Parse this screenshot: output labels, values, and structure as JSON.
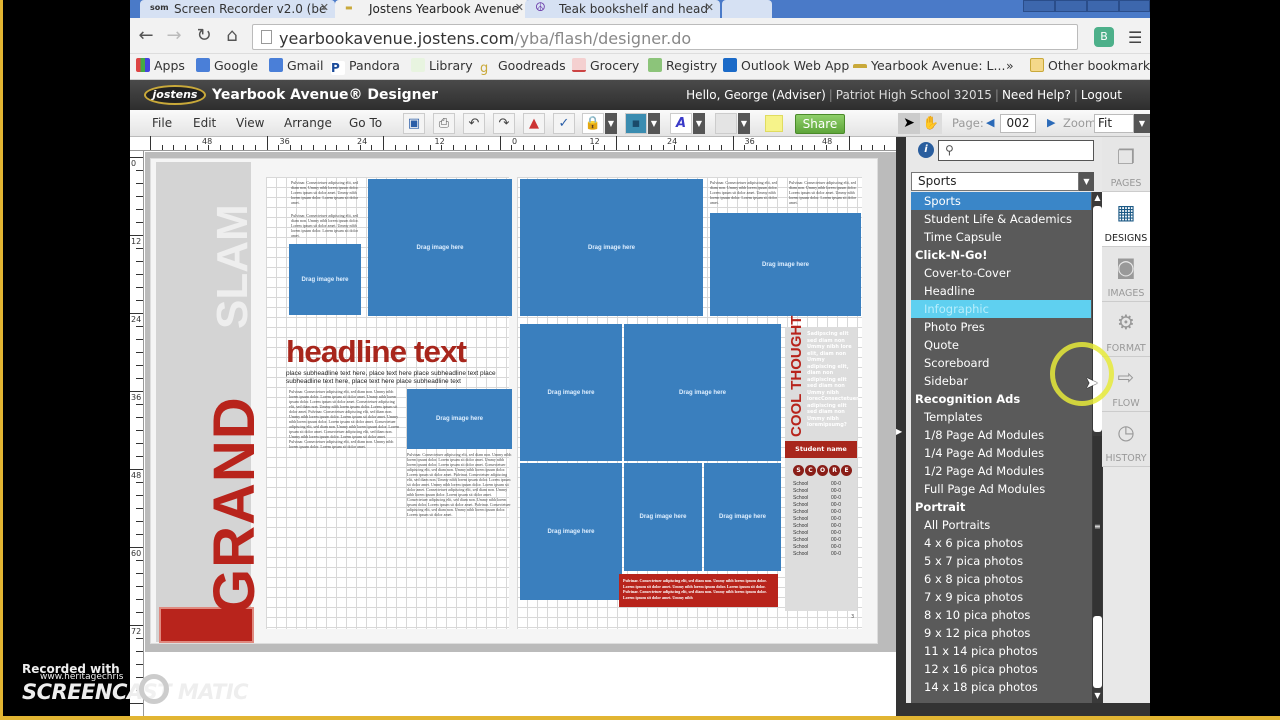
{
  "browser": {
    "tabs": [
      {
        "label": "Screen Recorder v2.0 (be",
        "icon": "som-icon",
        "active": false
      },
      {
        "label": "Jostens Yearbook Avenue",
        "icon": "yearbook-icon",
        "active": true
      },
      {
        "label": "Teak bookshelf and head",
        "icon": "peace-icon",
        "active": false
      }
    ],
    "url_domain": "yearbookavenue.jostens.com",
    "url_path": "/yba/flash/designer.do",
    "bookmarks": [
      {
        "label": "Apps",
        "icon": "apps-grid-icon",
        "color": "#d44"
      },
      {
        "label": "Google",
        "icon": "google-icon",
        "color": "#4a7fd8"
      },
      {
        "label": "Gmail",
        "icon": "gmail-icon",
        "color": "#4a7fd8"
      },
      {
        "label": "Pandora",
        "icon": "pandora-icon",
        "color": "#1a4a9a"
      },
      {
        "label": "Library",
        "icon": "library-icon",
        "color": "#7ab85a"
      },
      {
        "label": "Goodreads",
        "icon": "goodreads-icon",
        "color": "#c9a93a"
      },
      {
        "label": "Grocery",
        "icon": "grocery-icon",
        "color": "#c44"
      },
      {
        "label": "Registry",
        "icon": "registry-icon",
        "color": "#8cc47a"
      },
      {
        "label": "Outlook Web App",
        "icon": "outlook-icon",
        "color": "#1a6ac8"
      },
      {
        "label": "Yearbook Avenue: L...",
        "icon": "yearbook-icon",
        "color": "#c9a93a"
      }
    ],
    "more_bookmarks": "»",
    "other_bookmarks": "Other bookmarks"
  },
  "app": {
    "logo": "jostens",
    "title": "Yearbook Avenue® Designer",
    "greeting": "Hello, George (Adviser)",
    "school": "Patriot High School 32015",
    "help": "Need Help?",
    "logout": "Logout"
  },
  "toolbar": {
    "menus": [
      "File",
      "Edit",
      "View",
      "Arrange",
      "Go To"
    ],
    "share_label": "Share",
    "page_label": "Page:",
    "page_value": "002",
    "zoom_label": "Zoom",
    "zoom_value": "Fit"
  },
  "rulers": {
    "horizontal": [
      "48",
      "36",
      "24",
      "12",
      "0",
      "12",
      "24",
      "36",
      "48"
    ],
    "vertical": [
      "0",
      "12",
      "24",
      "36",
      "48",
      "60",
      "72"
    ]
  },
  "canvas": {
    "grand": "GRAND",
    "slam": "SLAM",
    "headline": "headline text",
    "subheadline": "place subheadline text here, place text here place subheadline text place subheadline text here, place text here place subheadline text",
    "image_placeholder": "Drag image here",
    "lorem": "Pulvinar. Consectetuer adipiscing elit, sed diam non. Ummy nibh lorem ipsum dolor. Lorem ipsum sit dolor amet. Ummy nibh lorem ipsum dolor. Lorem ipsum sit dolor amet.",
    "lorem_long": "Pulvinar. Consectetuer adipiscing elit, sed diam non. Ummy nibh lorem ipsum dolor. Lorem ipsum sit dolor amet. Ummy nibh lorem ipsum dolor. Lorem ipsum sit dolor amet. Consectetuer adipiscing elit, sed diam non. Ummy nibh lorem ipsum dolor. Lorem ipsum sit dolor amet. Pulvinar. Consectetuer adipiscing elit, sed diam non. Ummy nibh lorem ipsum dolor. Lorem ipsum sit dolor amet. Ummy nibh lorem ipsum dolor. Lorem ipsum sit dolor amet. Consectetuer adipiscing elit, sed diam non. Ummy nibh lorem ipsum dolor. Lorem ipsum sit dolor amet. Consectetuer adipiscing elit, sed diam non. Ummy nibh lorem ipsum dolor. Lorem ipsum sit dolor amet. Pulvinar. Consectetuer adipiscing elit, sed diam non. Ummy nibh lorem ipsum dolor. Lorem ipsum sit dolor amet.",
    "cool_thought": "COOL THOUGHT",
    "cool_text": "Sadipscing elit sed diam non Ummy nibh lore elit, diam non Ummy adipiscing elit, diam non adipiscing elit sed diam non Ummy nibh lorecConsectetuer adipiscing elit sed diam non Ummy nibh loremipsumg?",
    "student_name": "Student name",
    "score_letters": [
      "S",
      "C",
      "O",
      "R",
      "E"
    ],
    "score_rows": [
      {
        "team": "School",
        "score": "00-0"
      },
      {
        "team": "School",
        "score": "00-0"
      },
      {
        "team": "School",
        "score": "00-0"
      },
      {
        "team": "School",
        "score": "00-0"
      },
      {
        "team": "School",
        "score": "00-0"
      },
      {
        "team": "School",
        "score": "00-0"
      },
      {
        "team": "School",
        "score": "00-0"
      },
      {
        "team": "School",
        "score": "00-0"
      },
      {
        "team": "School",
        "score": "00-0"
      },
      {
        "team": "School",
        "score": "00-0"
      },
      {
        "team": "School",
        "score": "00-0"
      }
    ],
    "caption": "Pulvinar. Consectetuer adipiscing elit, sed diam non. Ummy nibh lorem ipsum dolor. Lorem ipsum sit dolor amet. Ummy nibh lorem ipsum dolor. Lorem ipsum sit dolor. Pulvinar. Consectetuer adipiscing elit, sed diam non. Ummy nibh lorem ipsum dolor. Lorem ipsum sit dolor amet. Ummy nibh",
    "page_number_right": "3"
  },
  "panel": {
    "search_placeholder": "",
    "category_selected": "Sports",
    "dropdown_items": [
      {
        "label": "Sports",
        "type": "item",
        "state": "selected"
      },
      {
        "label": "Student Life & Academics",
        "type": "item",
        "state": ""
      },
      {
        "label": "Time Capsule",
        "type": "item",
        "state": ""
      },
      {
        "label": "Click-N-Go!",
        "type": "header",
        "state": ""
      },
      {
        "label": "Cover-to-Cover",
        "type": "item",
        "state": ""
      },
      {
        "label": "Headline",
        "type": "item",
        "state": ""
      },
      {
        "label": "Infographic",
        "type": "item",
        "state": "hover"
      },
      {
        "label": "Photo Pres",
        "type": "item",
        "state": ""
      },
      {
        "label": "Quote",
        "type": "item",
        "state": ""
      },
      {
        "label": "Scoreboard",
        "type": "item",
        "state": ""
      },
      {
        "label": "Sidebar",
        "type": "item",
        "state": ""
      },
      {
        "label": "Recognition Ads",
        "type": "header",
        "state": ""
      },
      {
        "label": "Templates",
        "type": "item",
        "state": ""
      },
      {
        "label": "1/8 Page Ad Modules",
        "type": "item",
        "state": ""
      },
      {
        "label": "1/4 Page Ad Modules",
        "type": "item",
        "state": ""
      },
      {
        "label": "1/2 Page Ad Modules",
        "type": "item",
        "state": ""
      },
      {
        "label": "Full Page Ad Modules",
        "type": "item",
        "state": ""
      },
      {
        "label": "Portrait",
        "type": "header",
        "state": ""
      },
      {
        "label": "All Portraits",
        "type": "item",
        "state": ""
      },
      {
        "label": "4 x 6 pica photos",
        "type": "item",
        "state": ""
      },
      {
        "label": "5 x 7 pica photos",
        "type": "item",
        "state": ""
      },
      {
        "label": "6 x 8 pica photos",
        "type": "item",
        "state": ""
      },
      {
        "label": "7 x 9 pica photos",
        "type": "item",
        "state": ""
      },
      {
        "label": "8 x 10 pica photos",
        "type": "item",
        "state": ""
      },
      {
        "label": "9 x 12 pica photos",
        "type": "item",
        "state": ""
      },
      {
        "label": "11 x 14 pica photos",
        "type": "item",
        "state": ""
      },
      {
        "label": "12 x 16 pica photos",
        "type": "item",
        "state": ""
      },
      {
        "label": "14 x 18 pica photos",
        "type": "item",
        "state": ""
      }
    ],
    "side_tabs": [
      {
        "label": "PAGES",
        "icon": "pages-icon",
        "active": false
      },
      {
        "label": "DESIGNS",
        "icon": "designs-icon",
        "active": true
      },
      {
        "label": "IMAGES",
        "icon": "camera-icon",
        "active": false
      },
      {
        "label": "FORMAT",
        "icon": "gears-icon",
        "active": false
      },
      {
        "label": "FLOW",
        "icon": "flow-icon",
        "active": false
      },
      {
        "label": "HISTORY",
        "icon": "clock-icon",
        "active": false
      }
    ]
  },
  "watermark": {
    "recorded": "Recorded with",
    "url": "www.heritagechris",
    "brand": "SCREENCAST   MATIC"
  },
  "colors": {
    "accent_red": "#b8241c",
    "image_blue": "#3a7fbe",
    "selected_blue": "#3a86c8",
    "hover_cyan": "#5fd0f0",
    "share_green": "#5ea53a"
  }
}
